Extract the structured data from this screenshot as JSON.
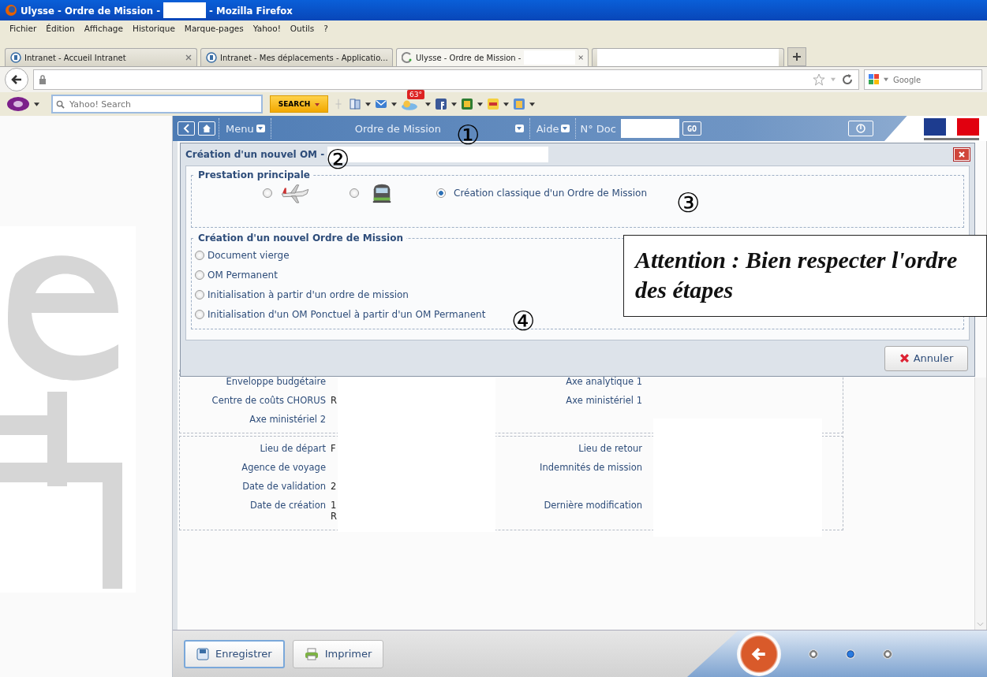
{
  "window": {
    "title_before": "Ulysse - Ordre de Mission -",
    "title_after": "- Mozilla Firefox"
  },
  "menu": [
    "Fichier",
    "Édition",
    "Affichage",
    "Historique",
    "Marque-pages",
    "Yahoo!",
    "Outils",
    "?"
  ],
  "tabs": [
    {
      "label": "Intranet - Accueil Intranet",
      "selected": false,
      "kind": "page"
    },
    {
      "label": "Intranet - Mes déplacements - Applicatio...",
      "selected": false,
      "kind": "page"
    },
    {
      "label": "Ulysse - Ordre de Mission -",
      "selected": true,
      "kind": "loading"
    },
    {
      "selected": false,
      "kind": "redacted"
    }
  ],
  "search_engine": {
    "placeholder": "Google"
  },
  "yahoo_toolbar": {
    "placeholder": "Yahoo! Search",
    "button": "SEARCH",
    "weather": "63°"
  },
  "app_header": {
    "menu": "Menu",
    "title": "Ordre de Mission",
    "help": "Aide",
    "doc_label": "N° Doc",
    "go": "GO"
  },
  "dialog": {
    "title": "Création d'un nouvel OM -",
    "section_1": {
      "legend": "Prestation principale",
      "options": [
        {
          "kind": "plane",
          "selected": false
        },
        {
          "kind": "train",
          "selected": false
        },
        {
          "kind": "text",
          "label": "Création classique d'un Ordre de Mission",
          "selected": true
        }
      ]
    },
    "section_2": {
      "legend": "Création d'un nouvel Ordre de Mission",
      "options": [
        {
          "label": "Document vierge",
          "selected": false
        },
        {
          "label": "OM Permanent",
          "selected": false
        },
        {
          "label": "Initialisation à partir d'un ordre de mission",
          "selected": false
        },
        {
          "label": "Initialisation d'un OM Ponctuel à partir d'un OM Permanent",
          "selected": false
        }
      ]
    },
    "cancel": "Annuler"
  },
  "form": {
    "section_1": [
      {
        "label": "Enveloppe budgétaire",
        "right_label": "Axe analytique 1"
      },
      {
        "label": "Centre de coûts CHORUS",
        "value": "R",
        "right_label": "Axe ministériel 1"
      },
      {
        "label": "Axe ministériel 2"
      }
    ],
    "section_2": [
      {
        "label": "Lieu de départ",
        "value": "F",
        "right_label": "Lieu de retour"
      },
      {
        "label": "Agence de voyage",
        "right_label": "Indemnités de mission"
      },
      {
        "label": "Date de validation",
        "value": "2"
      },
      {
        "label": "Date de création",
        "value": "1",
        "value_2": "R",
        "right_label": "Dernière modification"
      }
    ]
  },
  "footer": {
    "buttons": [
      "Enregistrer",
      "Imprimer"
    ],
    "pages": [
      {
        "selected": false
      },
      {
        "selected": true
      },
      {
        "selected": false
      }
    ]
  },
  "annotations": {
    "markers": [
      "①",
      "②",
      "③",
      "④"
    ],
    "callout": "Attention : Bien respecter l'ordre des étapes"
  }
}
